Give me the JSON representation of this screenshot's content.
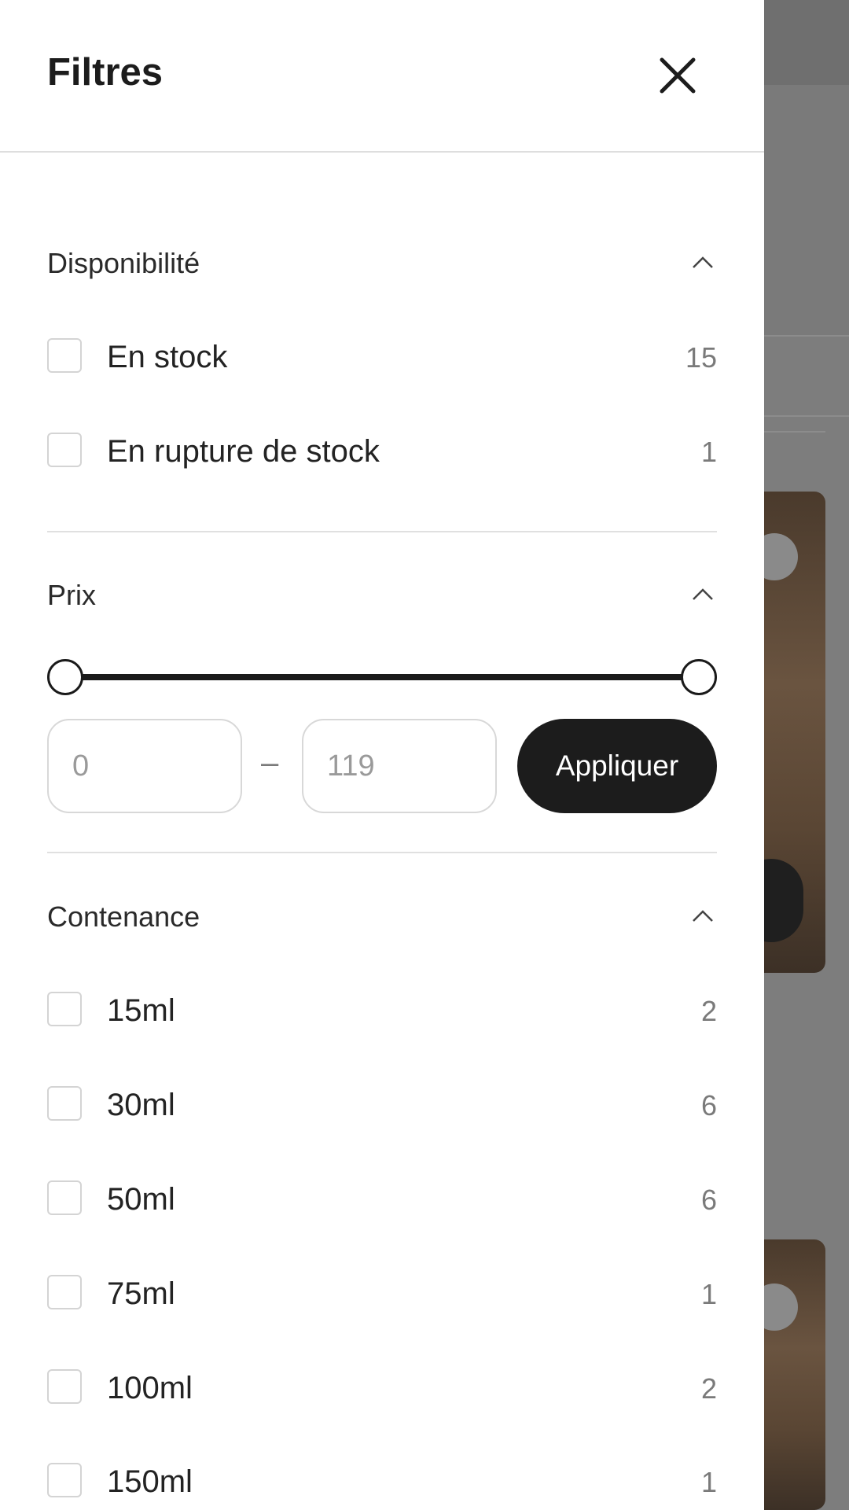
{
  "drawer": {
    "title": "Filtres",
    "close_icon": "close-icon"
  },
  "availability": {
    "title": "Disponibilité",
    "expanded": true,
    "options": [
      {
        "label": "En stock",
        "count": "15",
        "checked": false
      },
      {
        "label": "En rupture de stock",
        "count": "1",
        "checked": false
      }
    ]
  },
  "price": {
    "title": "Prix",
    "expanded": true,
    "min_placeholder": "0",
    "max_placeholder": "119",
    "separator": "–",
    "apply_label": "Appliquer",
    "range_low_fraction": 0,
    "range_high_fraction": 1
  },
  "capacity": {
    "title": "Contenance",
    "expanded": true,
    "options": [
      {
        "label": "15ml",
        "count": "2",
        "checked": false
      },
      {
        "label": "30ml",
        "count": "6",
        "checked": false
      },
      {
        "label": "50ml",
        "count": "6",
        "checked": false
      },
      {
        "label": "75ml",
        "count": "1",
        "checked": false
      },
      {
        "label": "100ml",
        "count": "2",
        "checked": false
      },
      {
        "label": "150ml",
        "count": "1",
        "checked": false
      }
    ]
  },
  "colors": {
    "accent": "#1c1c1c",
    "overlay": "#7d7d7d",
    "border": "#d4d4d4"
  }
}
